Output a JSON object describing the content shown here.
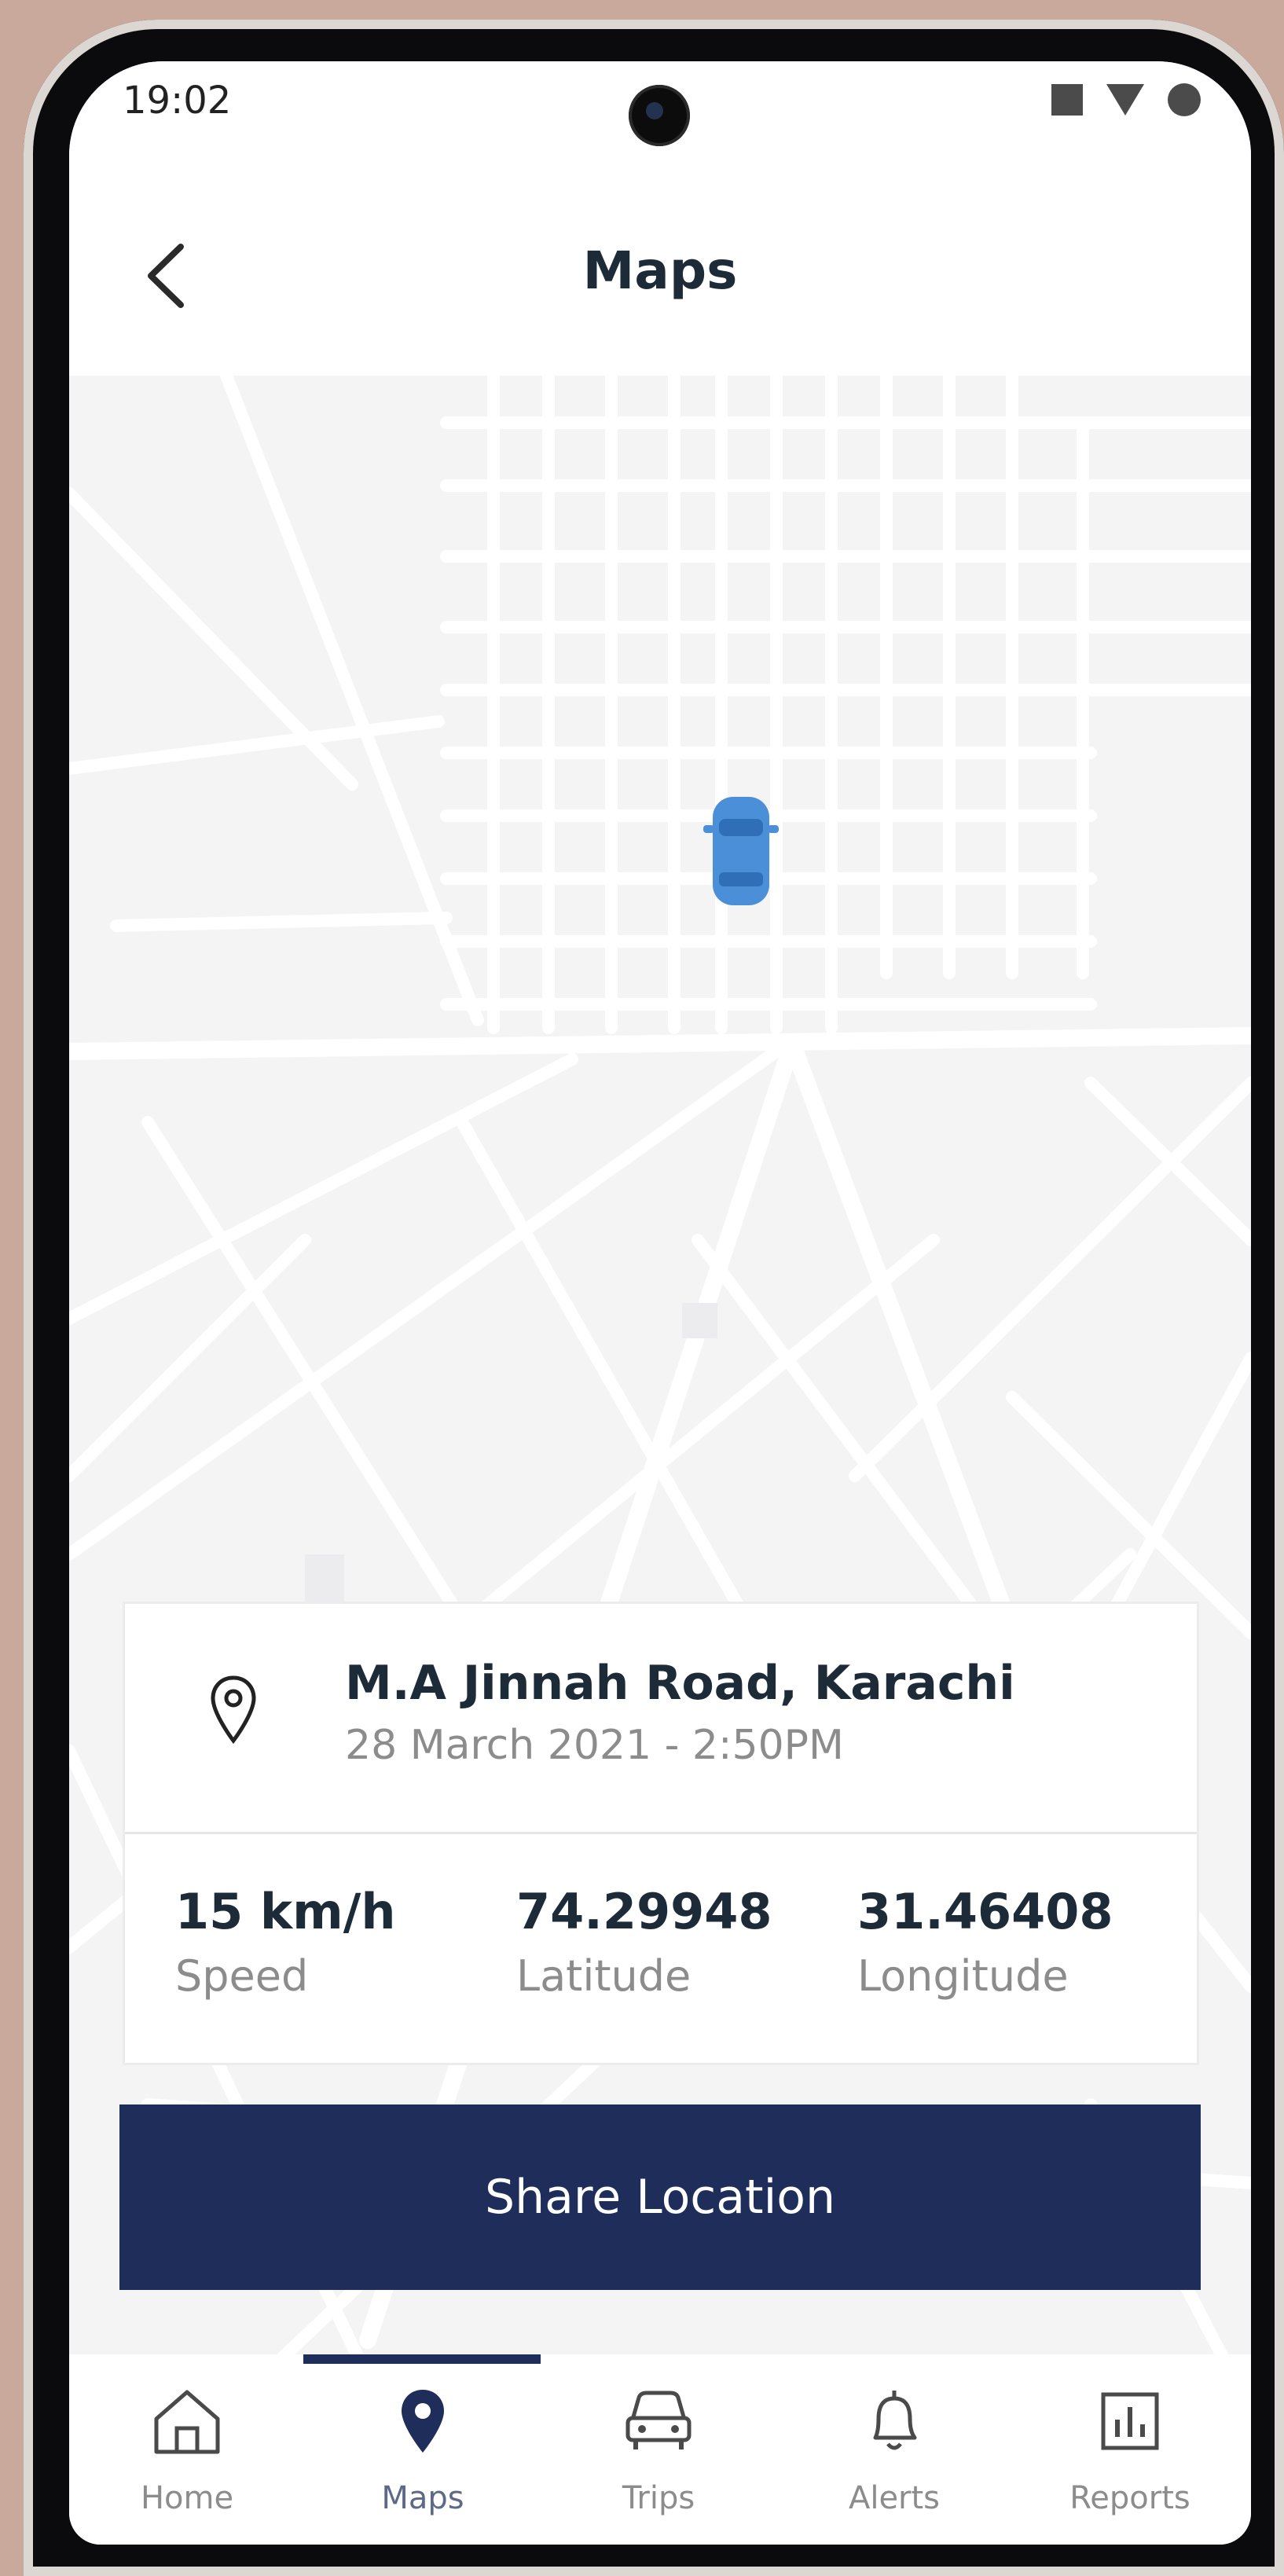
{
  "status_bar": {
    "time": "19:02"
  },
  "header": {
    "title": "Maps"
  },
  "location": {
    "address": "M.A Jinnah Road, Karachi",
    "datetime": "28 March 2021 - 2:50PM"
  },
  "stats": [
    {
      "value": "15 km/h",
      "label": "Speed"
    },
    {
      "value": "74.29948",
      "label": "Latitude"
    },
    {
      "value": "31.46408",
      "label": "Longitude"
    }
  ],
  "share_button": {
    "label": "Share Location"
  },
  "tabs": [
    {
      "label": "Home",
      "icon": "home-icon"
    },
    {
      "label": "Maps",
      "icon": "map-pin-icon",
      "active": true
    },
    {
      "label": "Trips",
      "icon": "car-icon"
    },
    {
      "label": "Alerts",
      "icon": "bell-icon"
    },
    {
      "label": "Reports",
      "icon": "bar-chart-icon"
    }
  ],
  "colors": {
    "primary": "#1e2d5a",
    "marker": "#4a8fd8",
    "map_bg": "#f4f4f5",
    "road": "#ffffff"
  }
}
